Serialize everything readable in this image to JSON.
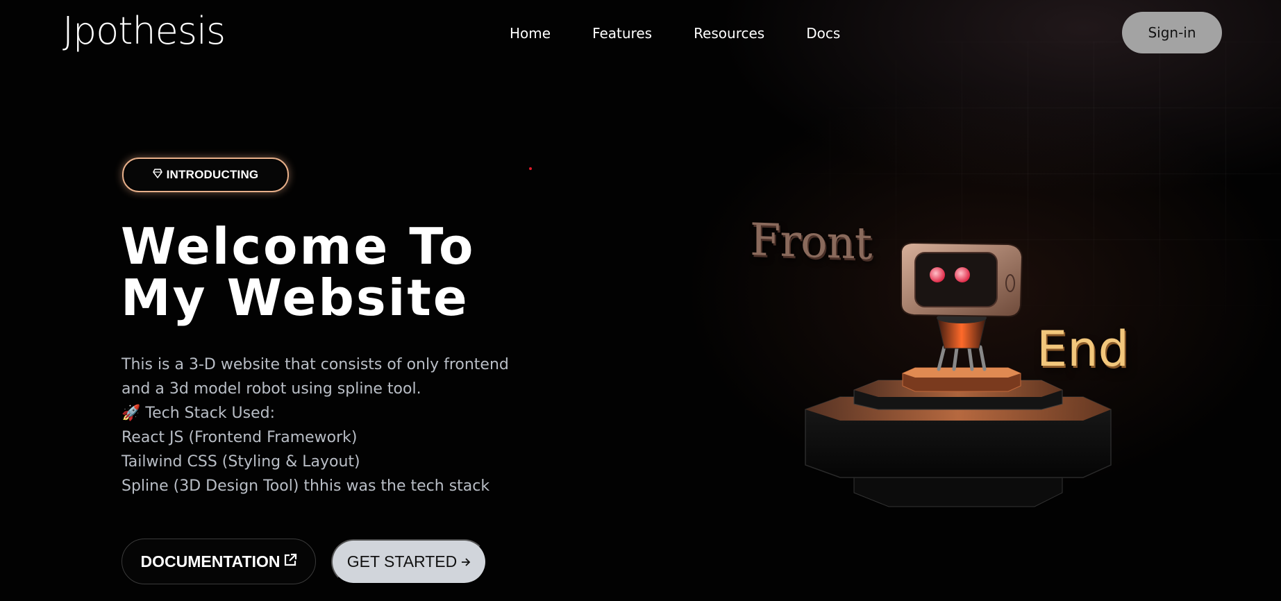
{
  "header": {
    "logo": "Jpothesis",
    "nav": [
      "Home",
      "Features",
      "Resources",
      "Docs"
    ],
    "signin_label": "Sign-in"
  },
  "hero": {
    "badge_label": "INTRODUCTING",
    "title_line1": "Welcome To",
    "title_line2": "My Website",
    "description": [
      "This is a 3-D website that consists of only frontend",
      "and a 3d model robot using spline tool.",
      "🚀 Tech Stack Used:",
      "React JS (Frontend Framework)",
      "Tailwind CSS (Styling & Layout)",
      "Spline (3D Design Tool) thhis was the tech stack"
    ],
    "doc_button": "DOCUMENTATION",
    "start_button": "GET STARTED"
  },
  "scene": {
    "front_word": "Front",
    "end_word": "End"
  },
  "icons": {
    "badge": "diamond-icon",
    "doc": "external-link-icon",
    "start": "arrow-right-icon"
  },
  "colors": {
    "background": "#020202",
    "signin_bg": "#a3a3a3",
    "start_bg": "#d1d5db",
    "badge_border": "#e8b08a",
    "body_text": "#b9bec6",
    "end_word": "#f2c77c"
  }
}
